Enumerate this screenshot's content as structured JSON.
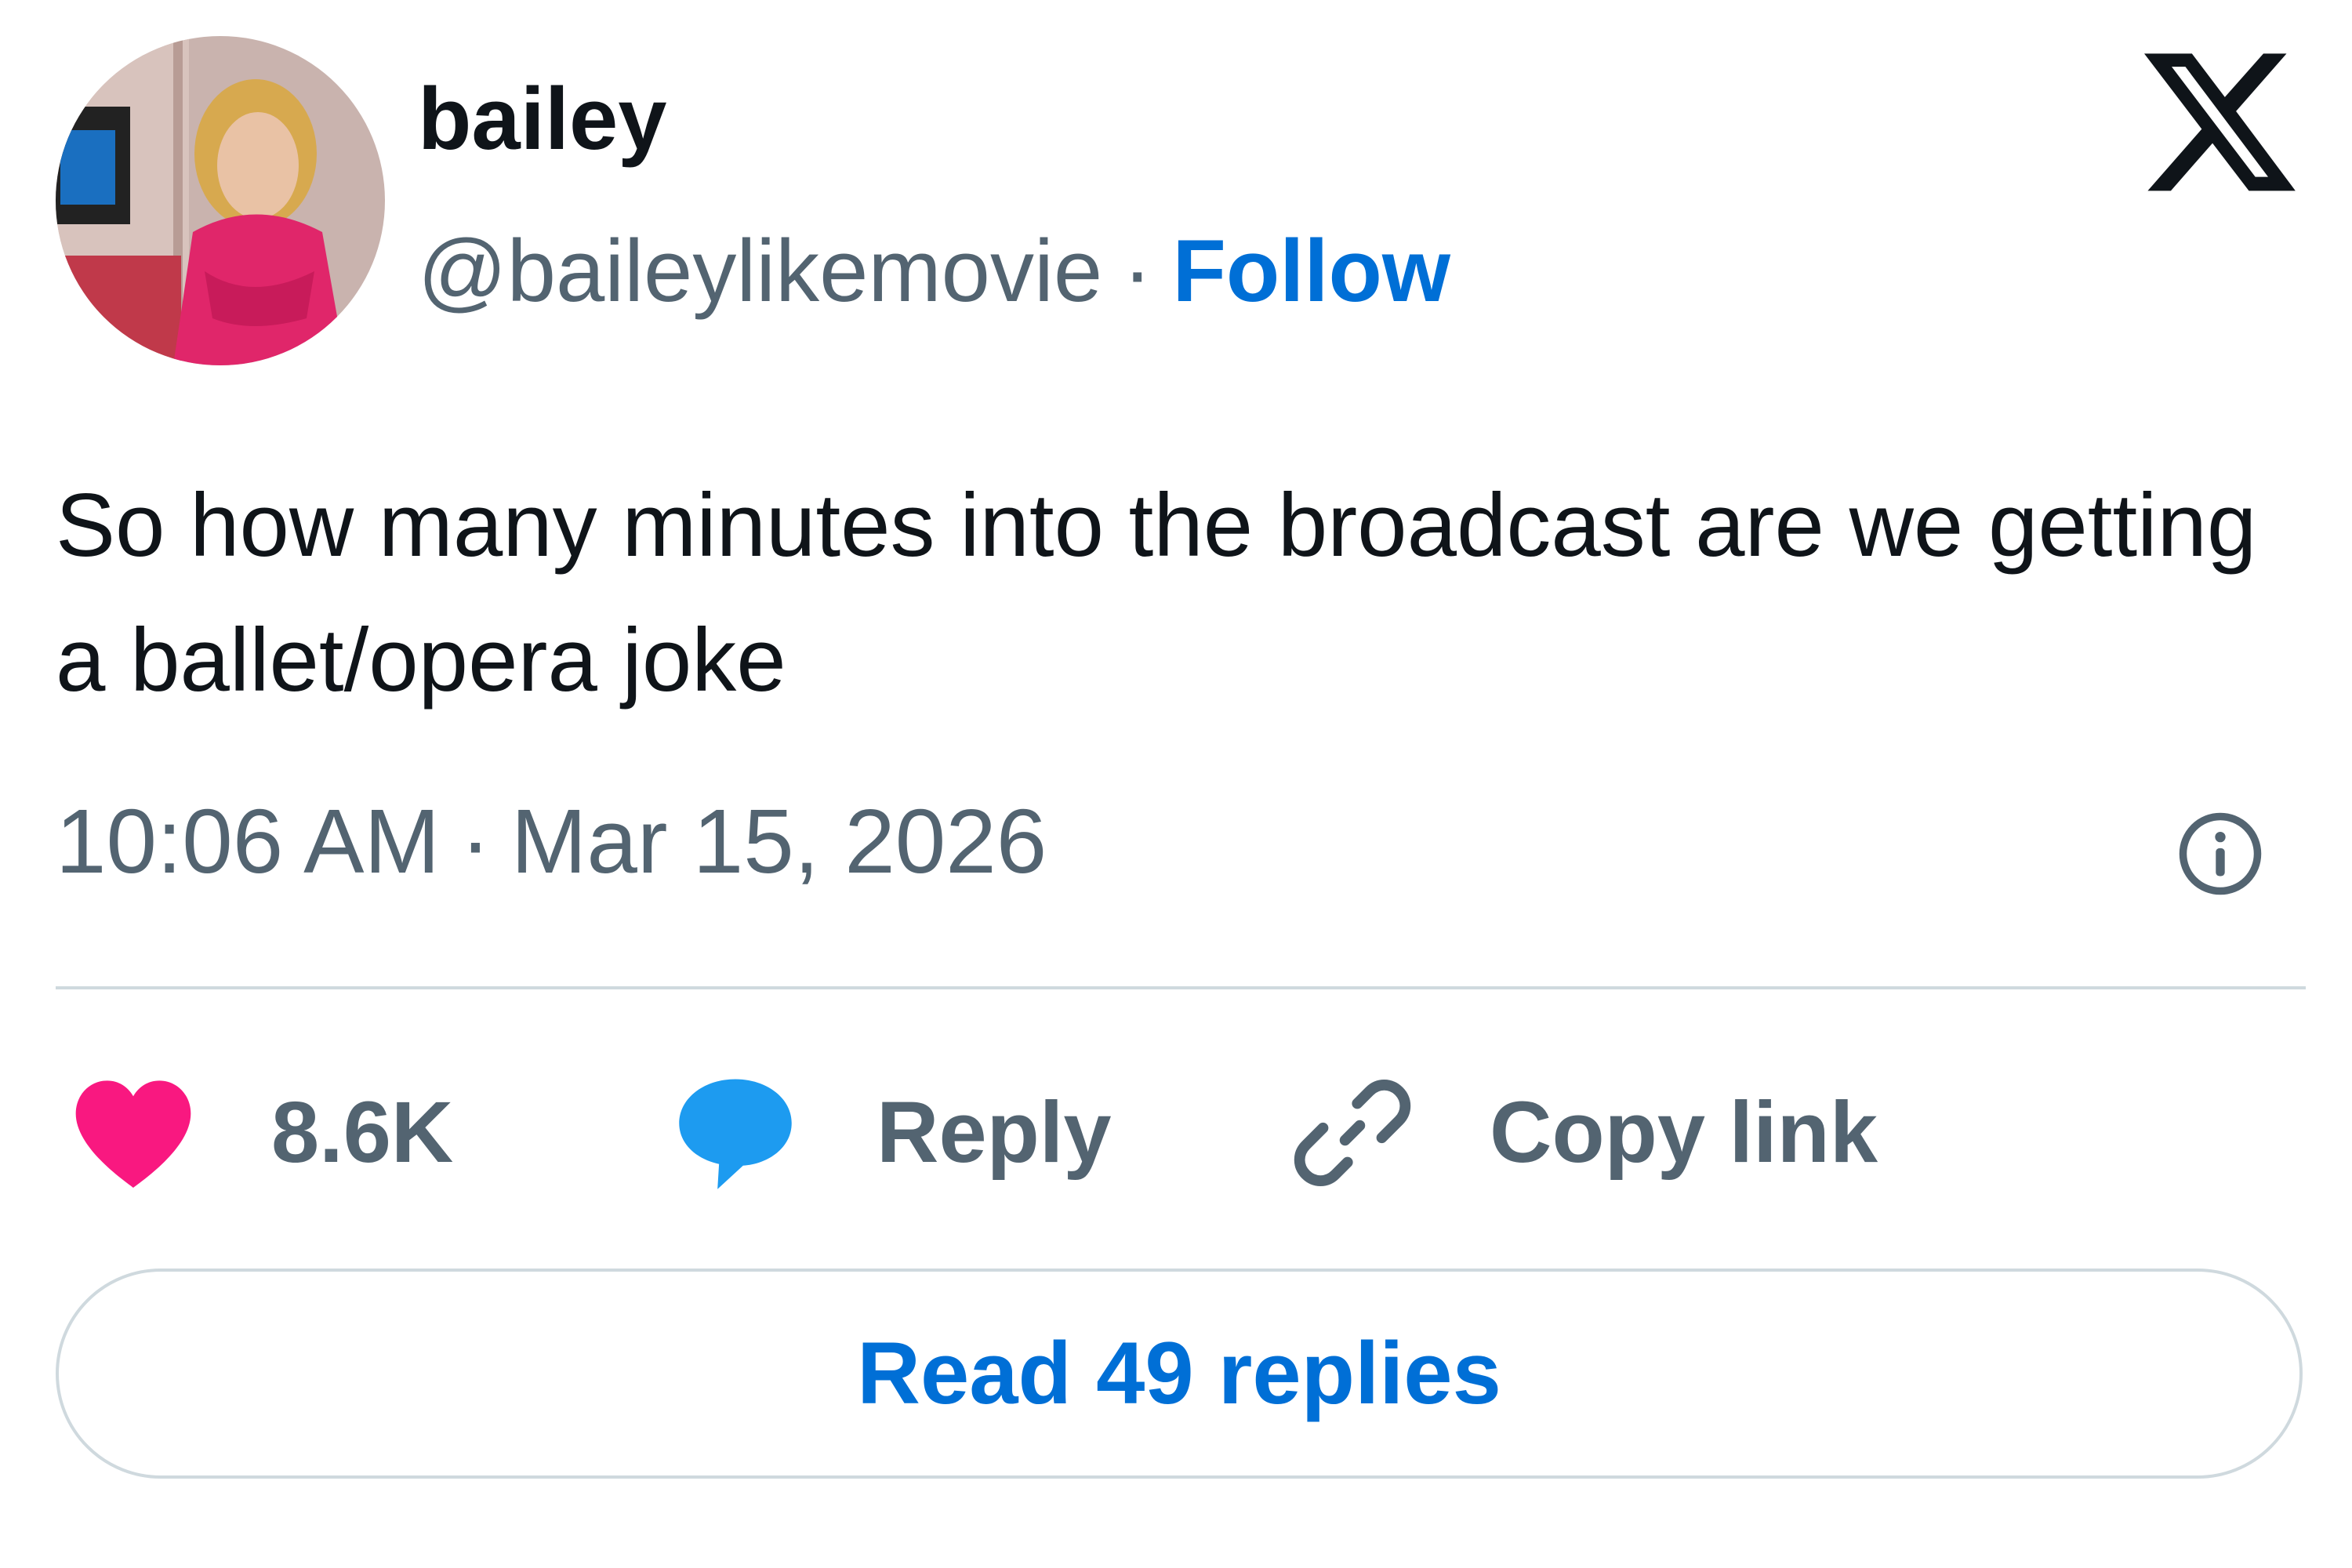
{
  "author": {
    "display_name": "bailey",
    "handle": "@baileylikemovie",
    "separator": "·",
    "follow_label": "Follow"
  },
  "tweet": {
    "text": "So how many minutes into the broadcast are we getting a ballet/opera joke",
    "time": "10:06 AM",
    "separator": "·",
    "date": "Mar 15, 2026"
  },
  "actions": {
    "likes_count": "8.6K",
    "reply_label": "Reply",
    "copy_link_label": "Copy link",
    "read_replies_label": "Read 49 replies"
  },
  "icons": {
    "brand": "x-logo-icon",
    "info": "info-icon",
    "like": "heart-icon",
    "reply": "speech-bubble-icon",
    "copy": "link-icon"
  },
  "colors": {
    "text_primary": "#0f1419",
    "text_secondary": "#536471",
    "link_blue": "#006fd6",
    "heart_pink": "#f91880",
    "reply_blue": "#1d9bf0",
    "border": "#cfd9de"
  }
}
